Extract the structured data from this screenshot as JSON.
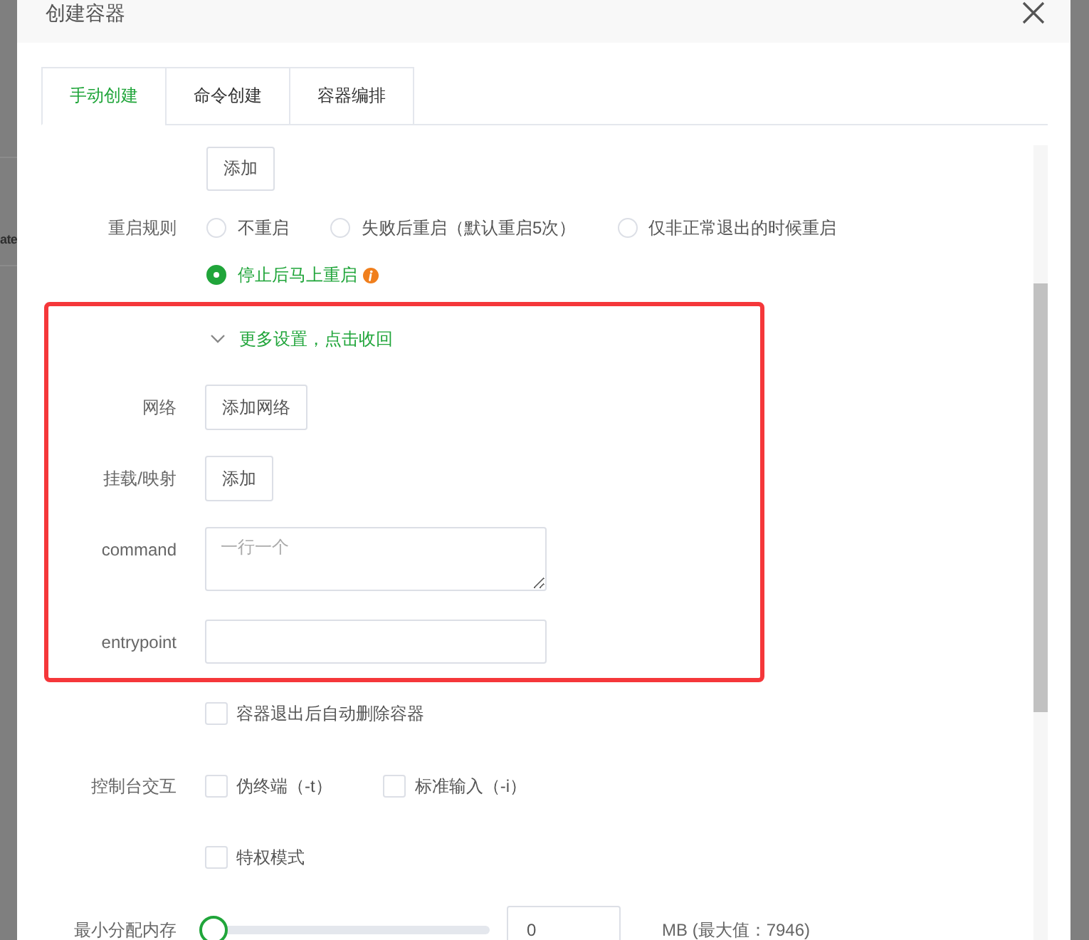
{
  "backdrop": {
    "text": "ate"
  },
  "dialog": {
    "title": "创建容器"
  },
  "tabs": [
    {
      "label": "手动创建",
      "selected": true
    },
    {
      "label": "命令创建",
      "selected": false
    },
    {
      "label": "容器编排",
      "selected": false
    }
  ],
  "form": {
    "add_button": "添加",
    "restart_policy": {
      "label": "重启规则",
      "options": [
        {
          "label": "不重启",
          "selected": false,
          "info": false
        },
        {
          "label": "失败后重启（默认重启5次）",
          "selected": false,
          "info": false
        },
        {
          "label": "仅非正常退出的时候重启",
          "selected": false,
          "info": false
        },
        {
          "label": "停止后马上重启",
          "selected": true,
          "info": true
        }
      ]
    },
    "more_settings": {
      "toggle": "更多设置，点击收回",
      "expanded": true,
      "highlighted": true,
      "rows": [
        {
          "kind": "button",
          "label": "网络",
          "button": "添加网络"
        },
        {
          "kind": "button",
          "label": "挂载/映射",
          "button": "添加"
        },
        {
          "kind": "textarea",
          "label": "command",
          "placeholder": "一行一个"
        },
        {
          "kind": "input",
          "label": "entrypoint"
        }
      ]
    },
    "option_rows": [
      {
        "checkboxes": [
          {
            "label": "容器退出后自动删除容器",
            "checked": false
          }
        ]
      },
      {
        "label": "控制台交互",
        "checkboxes": [
          {
            "label": "伪终端（-t）",
            "checked": false
          },
          {
            "label": "标准输入（-i）",
            "checked": false
          }
        ]
      },
      {
        "checkboxes": [
          {
            "label": "特权模式",
            "checked": false
          }
        ]
      }
    ],
    "min_memory": {
      "label": "最小分配内存",
      "level": 0,
      "value": "0",
      "unit": "MB (最大值：7946)"
    }
  }
}
